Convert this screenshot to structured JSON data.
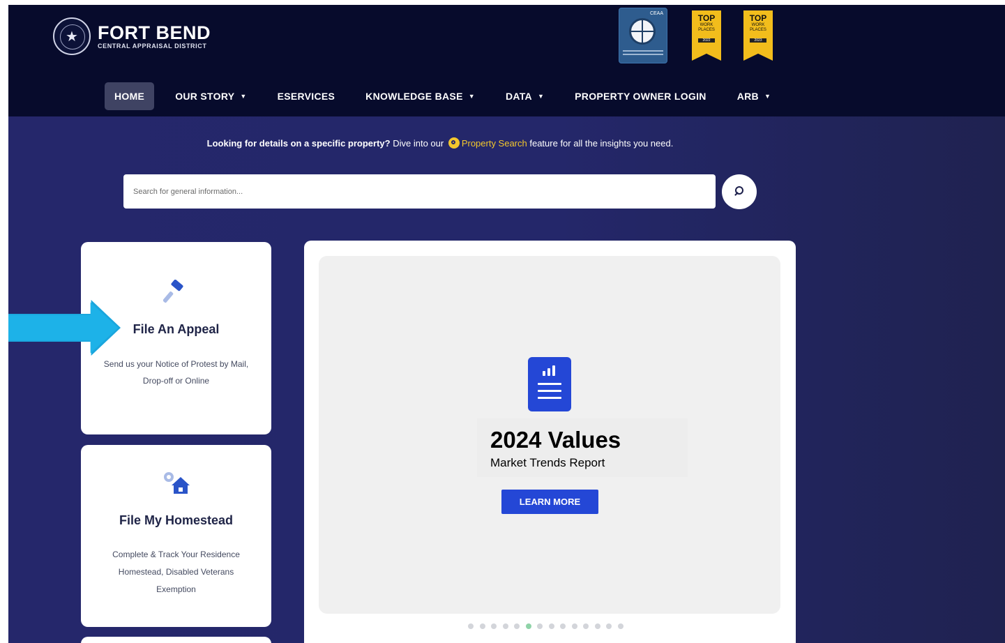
{
  "header": {
    "logo_name": "FORT BEND",
    "logo_sub": "CENTRAL APPRAISAL DISTRICT",
    "badges": [
      {
        "type": "ceaa",
        "label": "CEAA"
      },
      {
        "type": "top",
        "line1": "TOP",
        "line2": "WORK PLACES",
        "year": "2022"
      },
      {
        "type": "top",
        "line1": "TOP",
        "line2": "WORK PLACES",
        "year": "2023"
      }
    ]
  },
  "nav": {
    "items": [
      {
        "label": "HOME",
        "active": true,
        "has_caret": false
      },
      {
        "label": "OUR STORY",
        "active": false,
        "has_caret": true
      },
      {
        "label": "ESERVICES",
        "active": false,
        "has_caret": false
      },
      {
        "label": "KNOWLEDGE BASE",
        "active": false,
        "has_caret": true
      },
      {
        "label": "DATA",
        "active": false,
        "has_caret": true
      },
      {
        "label": "PROPERTY OWNER LOGIN",
        "active": false,
        "has_caret": false
      },
      {
        "label": "ARB",
        "active": false,
        "has_caret": true
      }
    ]
  },
  "intro": {
    "bold": "Looking for details on a specific property?",
    "text1": " Dive into our ",
    "link": "Property Search",
    "text2": " feature for all the insights you need."
  },
  "search": {
    "placeholder": "Search for general information...",
    "value": ""
  },
  "cards": [
    {
      "title": "File An Appeal",
      "desc_lines": [
        "Send us your Notice of Protest by Mail,",
        "Drop-off or Online"
      ],
      "icon": "gavel-icon"
    },
    {
      "title": "File My Homestead",
      "desc_lines": [
        "Complete & Track Your Residence",
        "Homestead, Disabled Veterans",
        "Exemption"
      ],
      "icon": "house-gear-icon"
    }
  ],
  "slide": {
    "title": "2024 Values",
    "subtitle": "Market Trends Report",
    "button": "LEARN MORE",
    "dot_count": 14,
    "active_dot": 5
  },
  "colors": {
    "header_bg": "#070b2c",
    "body_bg": "#25276b",
    "accent_blue": "#2447d6",
    "link_yellow": "#f3c72d",
    "arrow": "#1db2e8"
  }
}
